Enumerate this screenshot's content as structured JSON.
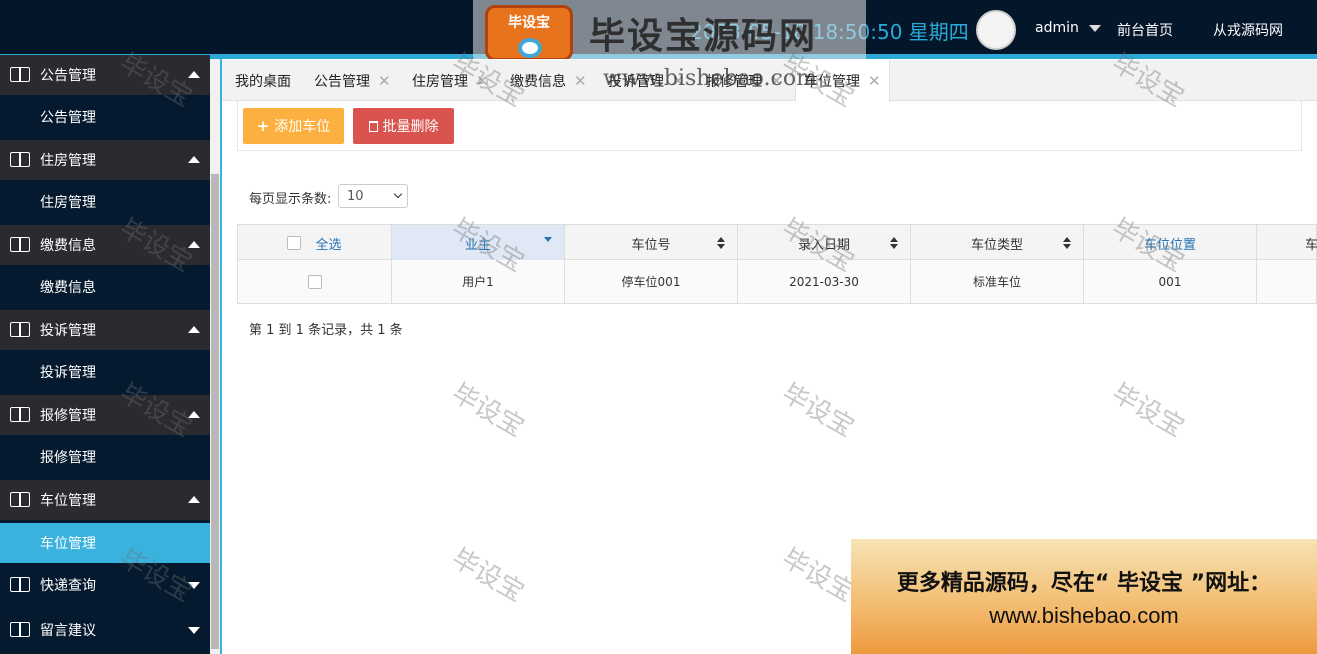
{
  "header": {
    "logo_badge": "毕设宝",
    "logo_title": "毕设宝源码网",
    "datetime": "2023-05-18 18:50:50  星期四",
    "username": "admin",
    "nav": [
      "前台首页",
      "从戎源码网"
    ]
  },
  "watermark": {
    "text": "毕设宝",
    "url": "www.bishebao.com"
  },
  "sidebar": {
    "groups": [
      {
        "label": "公告管理",
        "expanded": true,
        "sub": "公告管理"
      },
      {
        "label": "住房管理",
        "expanded": true,
        "sub": "住房管理"
      },
      {
        "label": "缴费信息",
        "expanded": true,
        "sub": "缴费信息"
      },
      {
        "label": "投诉管理",
        "expanded": true,
        "sub": "投诉管理"
      },
      {
        "label": "报修管理",
        "expanded": true,
        "sub": "报修管理"
      },
      {
        "label": "车位管理",
        "expanded": true,
        "sub": "车位管理"
      },
      {
        "label": "快递查询",
        "expanded": false
      },
      {
        "label": "留言建议",
        "expanded": false
      }
    ],
    "active_item": "车位管理"
  },
  "tabs": [
    {
      "label": "我的桌面",
      "closable": false
    },
    {
      "label": "公告管理",
      "closable": true
    },
    {
      "label": "住房管理",
      "closable": true
    },
    {
      "label": "缴费信息",
      "closable": true
    },
    {
      "label": "投诉管理",
      "closable": true
    },
    {
      "label": "报修管理",
      "closable": true
    },
    {
      "label": "车位管理",
      "closable": true,
      "active": true
    }
  ],
  "toolbar": {
    "add_label": "添加车位",
    "delete_label": "批量删除"
  },
  "pagination": {
    "page_size_label": "每页显示条数:",
    "page_size_value": "10",
    "summary": "第 1 到 1 条记录，共 1 条"
  },
  "table": {
    "select_all_label": "全选",
    "columns": [
      "业主",
      "车位号",
      "录入日期",
      "车位类型",
      "车位位置",
      "车"
    ],
    "rows": [
      [
        "用户1",
        "停车位001",
        "2021-03-30",
        "标准车位",
        "001",
        ""
      ]
    ]
  },
  "ad": {
    "line1": "更多精品源码，尽在“ 毕设宝 ”网址：",
    "line2": "www.bishebao.com"
  },
  "colors": {
    "header_bg": "#04172a",
    "accent": "#2ba8d8",
    "sidebar_bg": "#061a2f",
    "group_bg": "#2a2b30",
    "active_item": "#3ab2de",
    "btn_add": "#fcb040",
    "btn_delete": "#d9534f"
  }
}
